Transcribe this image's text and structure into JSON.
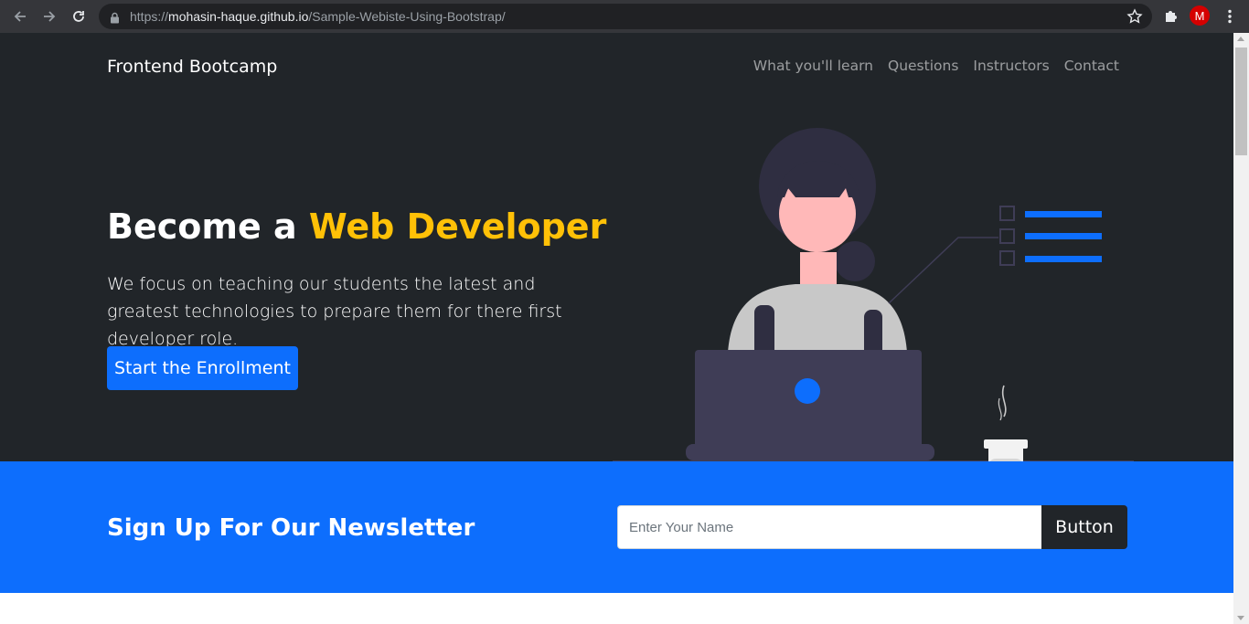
{
  "browser": {
    "url_prefix": "https://",
    "url_domain": "mohasin-haque.github.io",
    "url_path": "/Sample-Webiste-Using-Bootstrap/",
    "profile_initial": "M"
  },
  "navbar": {
    "brand": "Frontend Bootcamp",
    "links": [
      "What you'll learn",
      "Questions",
      "Instructors",
      "Contact"
    ]
  },
  "hero": {
    "headline_prefix": "Become a",
    "headline_accent": "Web Developer",
    "lead": "We focus on teaching our students the latest and greatest technologies to prepare them for there first developer role.",
    "cta_label": "Start the Enrollment"
  },
  "newsletter": {
    "title": "Sign Up For Our Newsletter",
    "input_placeholder": "Enter Your Name",
    "button_label": "Button"
  },
  "colors": {
    "hero_bg": "#212529",
    "accent": "#ffc107",
    "primary": "#0d6efd"
  }
}
